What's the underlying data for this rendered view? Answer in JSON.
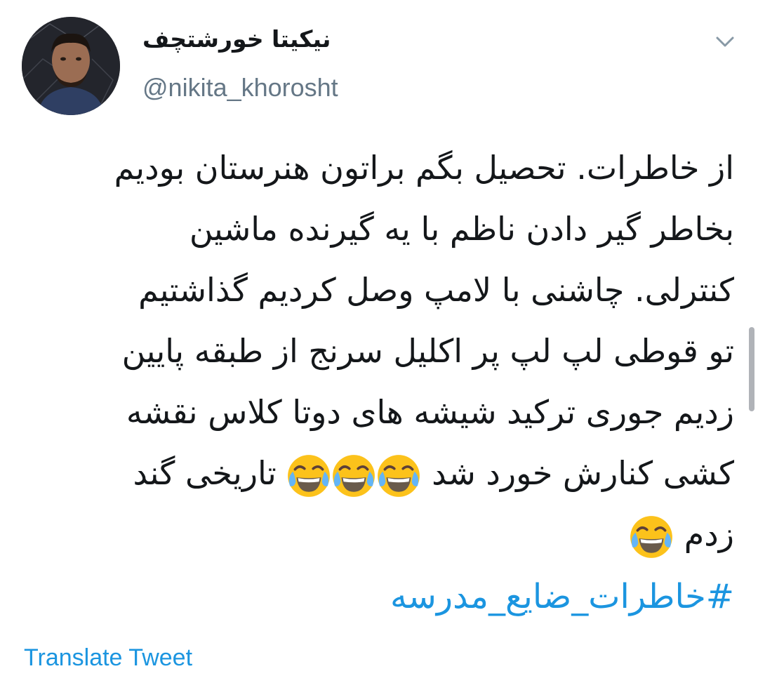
{
  "tweet": {
    "author": {
      "display_name": "نیکیتا خورشتچف",
      "handle": "@nikita_khorosht",
      "avatar_icon": "profile-photo-avatar"
    },
    "menu_icon": "chevron-down-icon",
    "lines": [
      "از خاطرات. تحصیل  بگم براتون هنرستان بودیم",
      "بخاطر گیر دادن ناظم با یه گیرنده ماشین",
      "کنترلی. چاشنی با لامپ  وصل کردیم گذاشتیم",
      "تو قوطی لپ لپ پر اکلیل سرنج  از طبقه پایین",
      "زدیم جوری ترکید شیشه های دوتا کلاس نقشه"
    ],
    "line6_text_a": "کشی کنارش خورد شد ",
    "line6_text_b": " تاریخی گند",
    "line7_text": "زدم ",
    "emoji_name": "face-with-tears-of-joy",
    "hashtag": "#خاطرات_ضایع_مدرسه",
    "translate_label": "Translate Tweet",
    "colors": {
      "link": "#1b95e0",
      "text": "#14171a",
      "muted": "#657786"
    }
  }
}
